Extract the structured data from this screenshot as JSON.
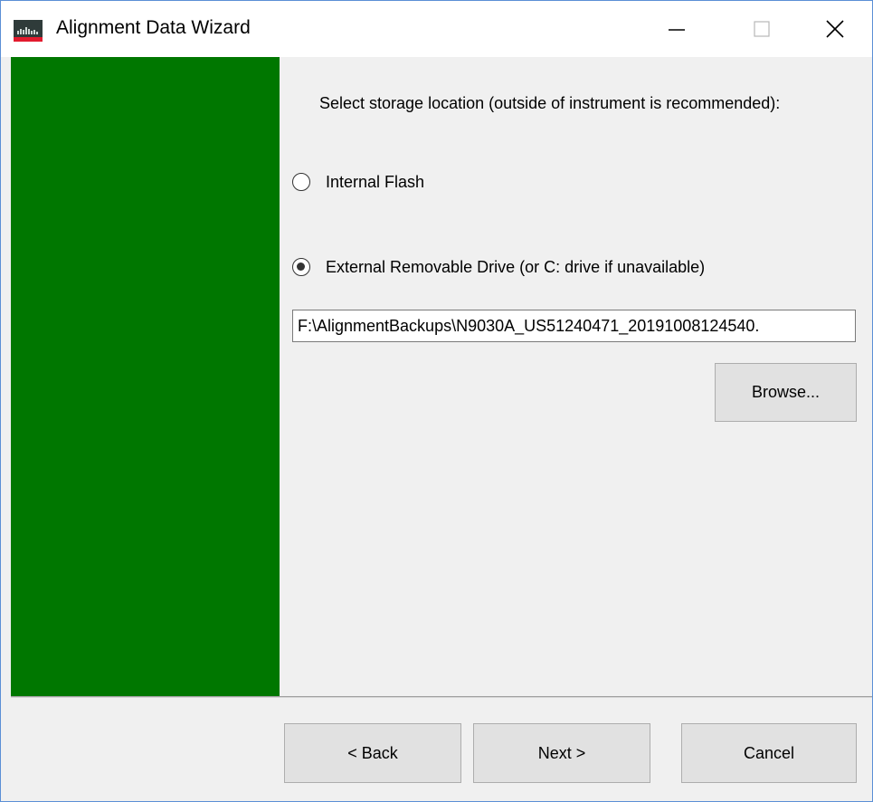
{
  "window": {
    "title": "Alignment Data Wizard",
    "icon": "keysight-app-icon",
    "controls": {
      "minimize_icon": "minimize-icon",
      "maximize_icon": "maximize-icon",
      "close_icon": "close-icon"
    }
  },
  "sidebar": {
    "color": "#007700"
  },
  "content": {
    "prompt": "Select storage location (outside of instrument is recommended):",
    "options": [
      {
        "label": "Internal Flash",
        "selected": false
      },
      {
        "label": "External Removable Drive (or C: drive if unavailable)",
        "selected": true
      }
    ],
    "path": {
      "value": "F:\\AlignmentBackups\\N9030A_US51240471_20191008124540."
    },
    "browse_label": "Browse..."
  },
  "footer": {
    "back_label": "< Back",
    "next_label": "Next >",
    "cancel_label": "Cancel"
  }
}
